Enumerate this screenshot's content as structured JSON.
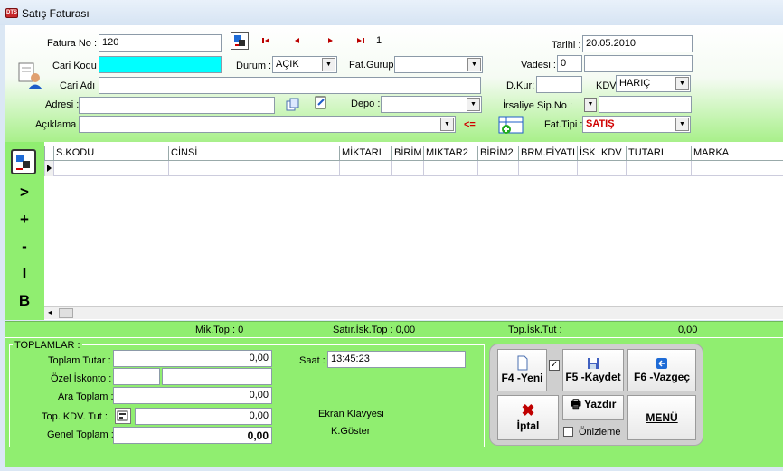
{
  "window": {
    "title": "Satış Faturası",
    "app_icon_text": "DTS"
  },
  "form": {
    "fatura_no_label": "Fatura No :",
    "fatura_no_value": "120",
    "record_index": "1",
    "cari_kodu_label": "Cari Kodu :",
    "cari_kodu_value": "",
    "durum_label": "Durum :",
    "durum_value": "AÇIK",
    "fat_gurup_label": "Fat.Gurup:",
    "fat_gurup_value": "",
    "cari_adi_label": "Cari Adı :",
    "cari_adi_value": "",
    "adresi_label": "Adresi :",
    "adresi_value": "",
    "depo_label": "Depo :",
    "depo_value": "",
    "aciklama_label": "Açıklama :",
    "aciklama_value": "",
    "arrow_label": "<=",
    "tarihi_label": "Tarihi :",
    "tarihi_value": "20.05.2010",
    "vadesi_label": "Vadesi :",
    "vadesi_value": "0",
    "dkur_label": "D.Kur:",
    "dkur_value": "",
    "kdv_label": "KDV",
    "kdv_value": "HARIÇ",
    "irsaliye_label": "İrsaliye Sip.No :",
    "irsaliye_value": "",
    "fat_tipi_label": "Fat.Tipi :",
    "fat_tipi_value": "SATIŞ"
  },
  "grid": {
    "columns": [
      "S.KODU",
      "CİNSİ",
      "MİKTARI",
      "BİRİM",
      "MIKTAR2",
      "BİRİM2",
      "BRM.FİYATI",
      "İSK",
      "KDV",
      "TUTARI",
      "MARKA"
    ],
    "side_buttons": [
      ">",
      "+",
      "-",
      "I",
      "B"
    ]
  },
  "summary": {
    "mik_top": "Mik.Top : 0",
    "satir_isk_top": "Satır.İsk.Top :  0,00",
    "top_isk_tut": "Top.İsk.Tut :",
    "top_isk_value": "0,00"
  },
  "totals": {
    "group_title": "TOPLAMLAR :",
    "toplam_tutar_label": "Toplam Tutar :",
    "toplam_tutar_value": "0,00",
    "ozel_iskonto_label": "Özel İskonto :",
    "ozel_iskonto_value1": "",
    "ozel_iskonto_value2": "",
    "ara_toplam_label": "Ara Toplam :",
    "ara_toplam_value": "0,00",
    "top_kdv_label": "Top. KDV. Tut :",
    "top_kdv_value": "0,00",
    "genel_toplam_label": "Genel Toplam :",
    "genel_toplam_value": "0,00",
    "saat_label": "Saat :",
    "saat_value": "13:45:23",
    "ekran_klavyesi": "Ekran Klavyesi",
    "k_goster": "K.Göster"
  },
  "buttons": {
    "yeni": "F4 -Yeni",
    "kaydet": "F5 -Kaydet",
    "vazgec": "F6 -Vazgeç",
    "iptal": "İptal",
    "yazdir": "Yazdır",
    "onizleme": "Önizleme",
    "menu": "MENÜ"
  },
  "colors": {
    "accent_green": "#90ee70",
    "fat_tipi_red": "#d00000",
    "cari_kodu_cyan": "#00ffff"
  }
}
